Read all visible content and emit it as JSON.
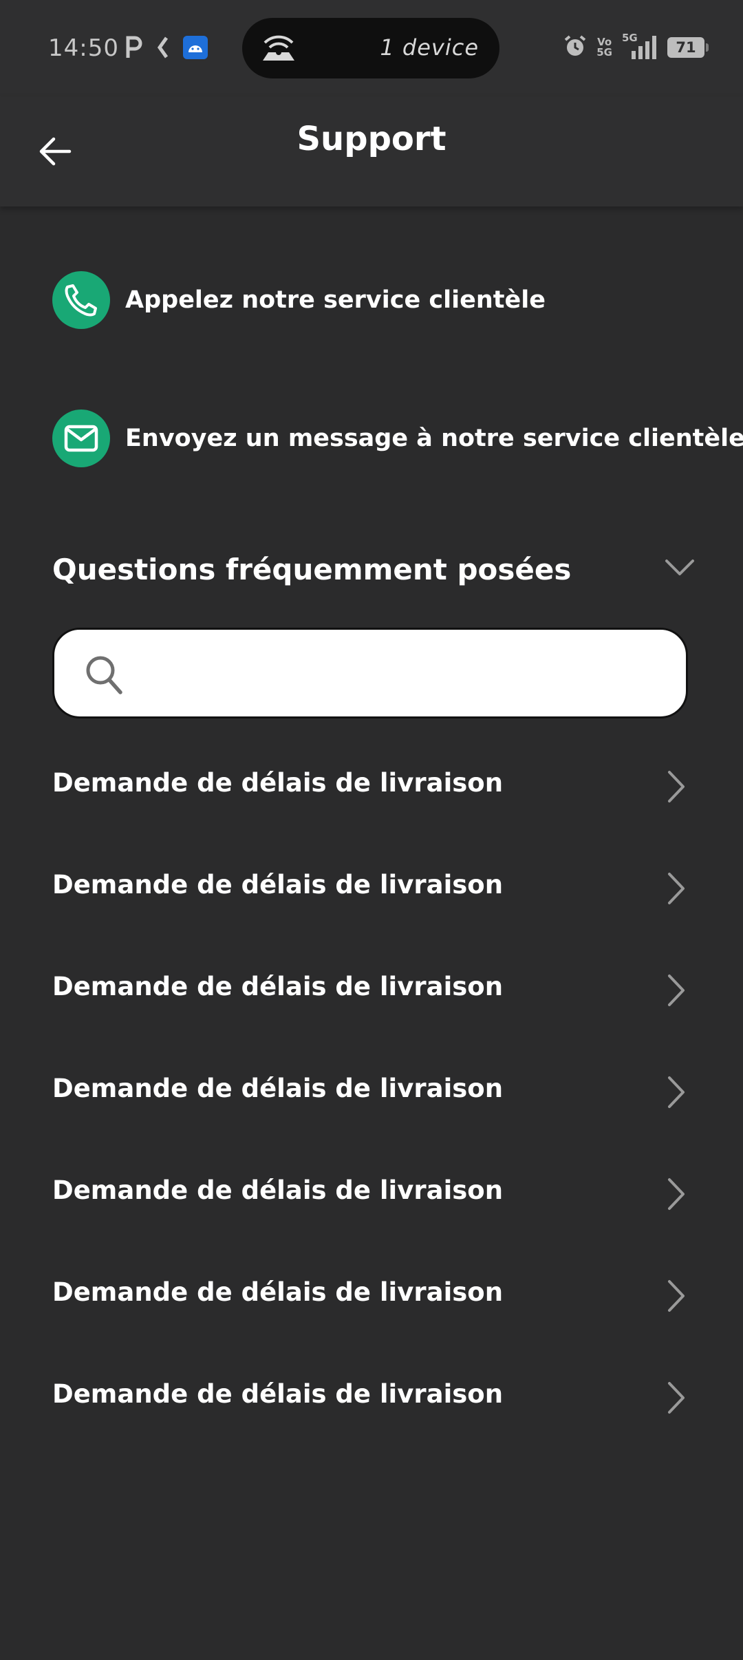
{
  "status_bar": {
    "time": "14:50",
    "hotspot_text": "1 device",
    "network_label_top": "Vo",
    "network_label_bottom": "5G",
    "signal_label": "5G",
    "battery_level": "71"
  },
  "header": {
    "title": "Support"
  },
  "contact": {
    "call_label": "Appelez notre service clientèle",
    "message_label": "Envoyez un message à notre service clientèle"
  },
  "faq": {
    "title": "Questions fréquemment posées",
    "search_placeholder": "",
    "items": [
      {
        "label": "Demande de délais de livraison"
      },
      {
        "label": "Demande de délais de livraison"
      },
      {
        "label": "Demande de délais de livraison"
      },
      {
        "label": "Demande de délais de livraison"
      },
      {
        "label": "Demande de délais de livraison"
      },
      {
        "label": "Demande de délais de livraison"
      },
      {
        "label": "Demande de délais de livraison"
      }
    ]
  },
  "colors": {
    "background": "#2b2b2c",
    "accent": "#19a875",
    "text": "#ffffff",
    "chevron": "#9a9a9a"
  }
}
